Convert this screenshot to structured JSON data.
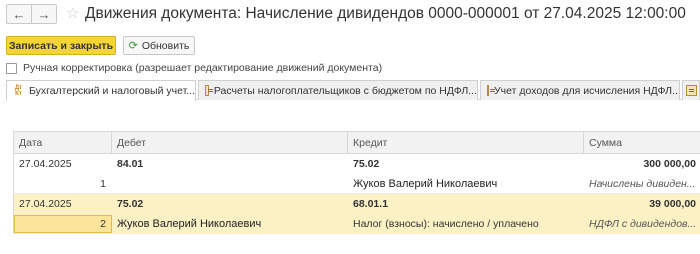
{
  "window": {
    "title": "Движения документа: Начисление дивидендов 0000-000001 от 27.04.2025  12:00:00",
    "back_icon": "arrow-left-icon",
    "forward_icon": "arrow-right-icon",
    "favorite_icon": "star-icon"
  },
  "toolbar": {
    "save_close_label": "Записать и закрыть",
    "refresh_label": "Обновить",
    "refresh_icon": "refresh-icon",
    "primary_color": "#f5d533"
  },
  "manual_adjust": {
    "label": "Ручная корректировка (разрешает редактирование движений документа)",
    "checked": false
  },
  "tabs": [
    {
      "label": "Бухгалтерский и налоговый учет...",
      "icon": "dt-kt-icon",
      "active": true
    },
    {
      "label": "Расчеты налогоплательщиков с бюджетом по НДФЛ...",
      "icon": "register-icon",
      "active": false
    },
    {
      "label": "Учет доходов для исчисления НДФЛ...",
      "icon": "register-icon",
      "active": false
    }
  ],
  "grid": {
    "columns": {
      "date": "Дата",
      "debet": "Дебет",
      "kredit": "Кредит",
      "sum": "Сумма"
    },
    "records": [
      {
        "date": "27.04.2025",
        "debet": "84.01",
        "kredit": "75.02",
        "sum": "300 000,00",
        "index": "1",
        "debet_sub": "",
        "kredit_sub": "Жуков Валерий Николаевич",
        "content": "Начислены дивиден..."
      },
      {
        "date": "27.04.2025",
        "debet": "75.02",
        "kredit": "68.01.1",
        "sum": "39 000,00",
        "index": "2",
        "debet_sub": "Жуков Валерий Николаевич",
        "kredit_sub": "Налог (взносы): начислено / уплачено",
        "content": "НДФЛ с дивидендов..."
      }
    ],
    "highlight_color": "#fbf1c4"
  }
}
